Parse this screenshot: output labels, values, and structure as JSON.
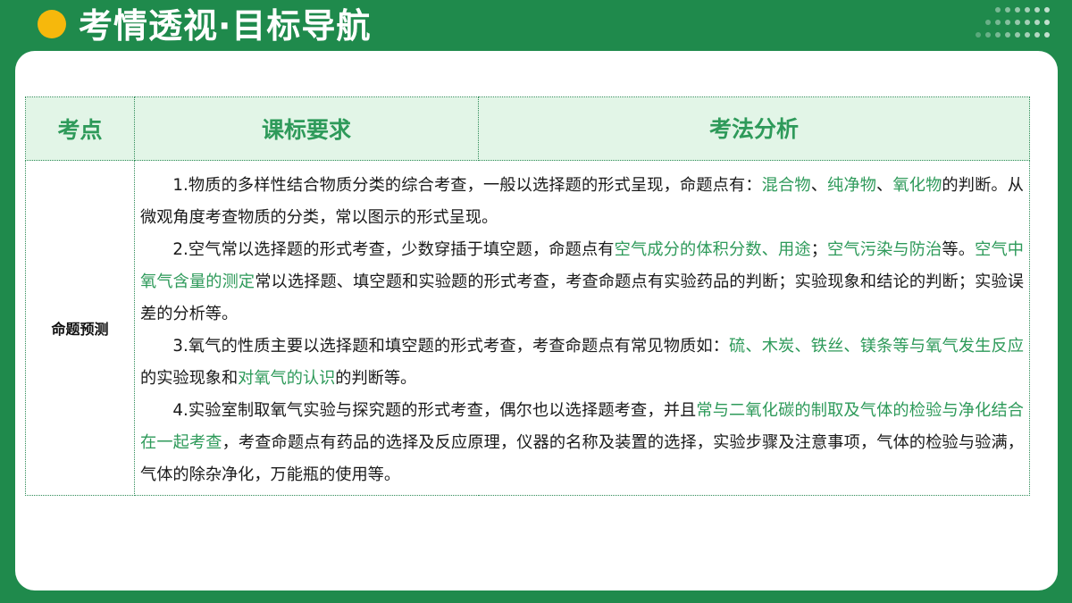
{
  "header": {
    "title": "考情透视·目标导航"
  },
  "colors": {
    "background": "#1f8a4c",
    "accent_dot": "#f6b80c",
    "highlight": "#2e9a5a",
    "header_fill": "#e2f5e7"
  },
  "table": {
    "headers": [
      "考点",
      "课标要求",
      "考法分析"
    ],
    "row_label": "命题预测",
    "paragraphs": [
      [
        {
          "t": "1.物质的多样性结合物质分类的综合考查，一般以选择题的形式呈现，命题点有："
        },
        {
          "t": "混合物",
          "hl": true
        },
        {
          "t": "、"
        },
        {
          "t": "纯净物",
          "hl": true
        },
        {
          "t": "、"
        },
        {
          "t": "氧化物",
          "hl": true
        },
        {
          "t": "的判断。从微观角度考查物质的分类，常以图示的形式呈现。"
        }
      ],
      [
        {
          "t": "2.空气常以选择题的形式考查，少数穿插于填空题，命题点有"
        },
        {
          "t": "空气成分的体积分数、用途",
          "hl": true
        },
        {
          "t": "；"
        },
        {
          "t": "空气污染与防治",
          "hl": true
        },
        {
          "t": "等。"
        },
        {
          "t": "空气中氧气含量的测定",
          "hl": true
        },
        {
          "t": "常以选择题、填空题和实验题的形式考查，考查命题点有实验药品的判断；实验现象和结论的判断；实验误差的分析等。"
        }
      ],
      [
        {
          "t": "3.氧气的性质主要以选择题和填空题的形式考查，考查命题点有常见物质如："
        },
        {
          "t": "硫、木炭、铁丝、镁条等与氧气发生反应",
          "hl": true
        },
        {
          "t": "的实验现象和"
        },
        {
          "t": "对氧气的认识",
          "hl": true
        },
        {
          "t": "的判断等。"
        }
      ],
      [
        {
          "t": "4.实验室制取氧气实验与探究题的形式考查，偶尔也以选择题考查，并且"
        },
        {
          "t": "常与二氧化碳的制取及气体的检验与净化结合在一起考查",
          "hl": true
        },
        {
          "t": "，考查命题点有药品的选择及反应原理，仪器的名称及装置的选择，实验步骤及注意事项，气体的检验与验满，气体的除杂净化，万能瓶的使用等。"
        }
      ]
    ]
  }
}
